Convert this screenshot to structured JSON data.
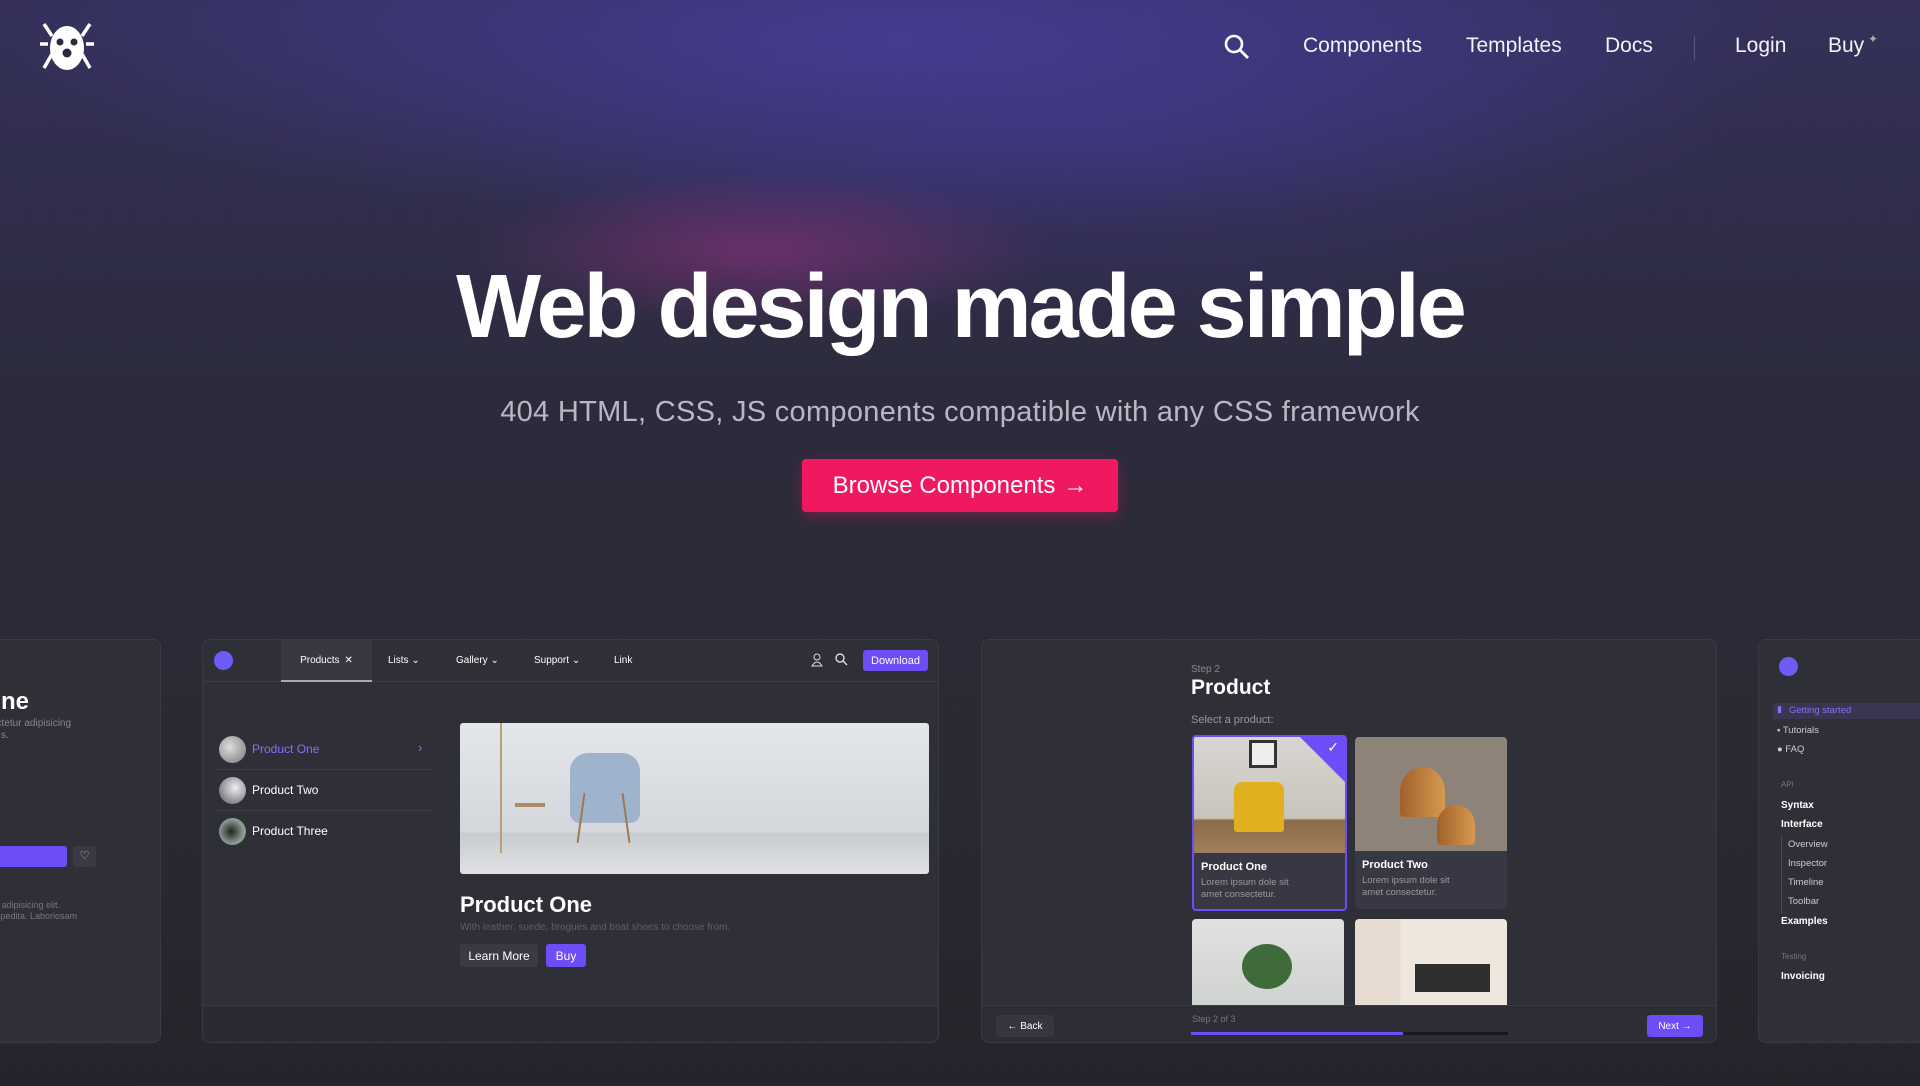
{
  "nav": {
    "items": [
      "Components",
      "Templates",
      "Docs"
    ],
    "login": "Login",
    "buy": "Buy"
  },
  "hero": {
    "title": "Web design made simple",
    "subtitle": "404 HTML, CSS, JS components compatible with any CSS framework",
    "cta": "Browse Components"
  },
  "colors": {
    "accent": "#6d4df5",
    "cta": "#f0185f"
  },
  "left_card": {
    "heading": "ne",
    "text1": "ectetur adipisicing",
    "text1b": "s.",
    "text2": "ur adipisicing elit.",
    "text2b": "expedita. Laboriosam"
  },
  "shop_card": {
    "tabs": [
      "Products",
      "Lists",
      "Gallery",
      "Support",
      "Link"
    ],
    "download": "Download",
    "list": [
      "Product One",
      "Product Two",
      "Product Three"
    ],
    "title": "Product One",
    "desc": "With leather, suede, brogues and boat shoes to choose from.",
    "learn_more": "Learn More",
    "buy": "Buy"
  },
  "wizard": {
    "step": "Step 2",
    "title": "Product",
    "prompt": "Select a product:",
    "products": [
      {
        "name": "Product One",
        "desc": "Lorem ipsum dole sit amet consectetur."
      },
      {
        "name": "Product Two",
        "desc": "Lorem ipsum dole sit amet consectetur."
      }
    ],
    "back": "← Back",
    "progress_label": "Step 2 of 3",
    "progress": 0.67,
    "next": "Next →"
  },
  "docs": {
    "top": [
      "Getting started",
      "Tutorials",
      "FAQ"
    ],
    "api_label": "API",
    "api": [
      "Syntax",
      "Interface"
    ],
    "sub": [
      "Overview",
      "Inspector",
      "Timeline",
      "Toolbar"
    ],
    "examples": "Examples",
    "testing_label": "Testing",
    "testing": [
      "Invoicing"
    ]
  }
}
